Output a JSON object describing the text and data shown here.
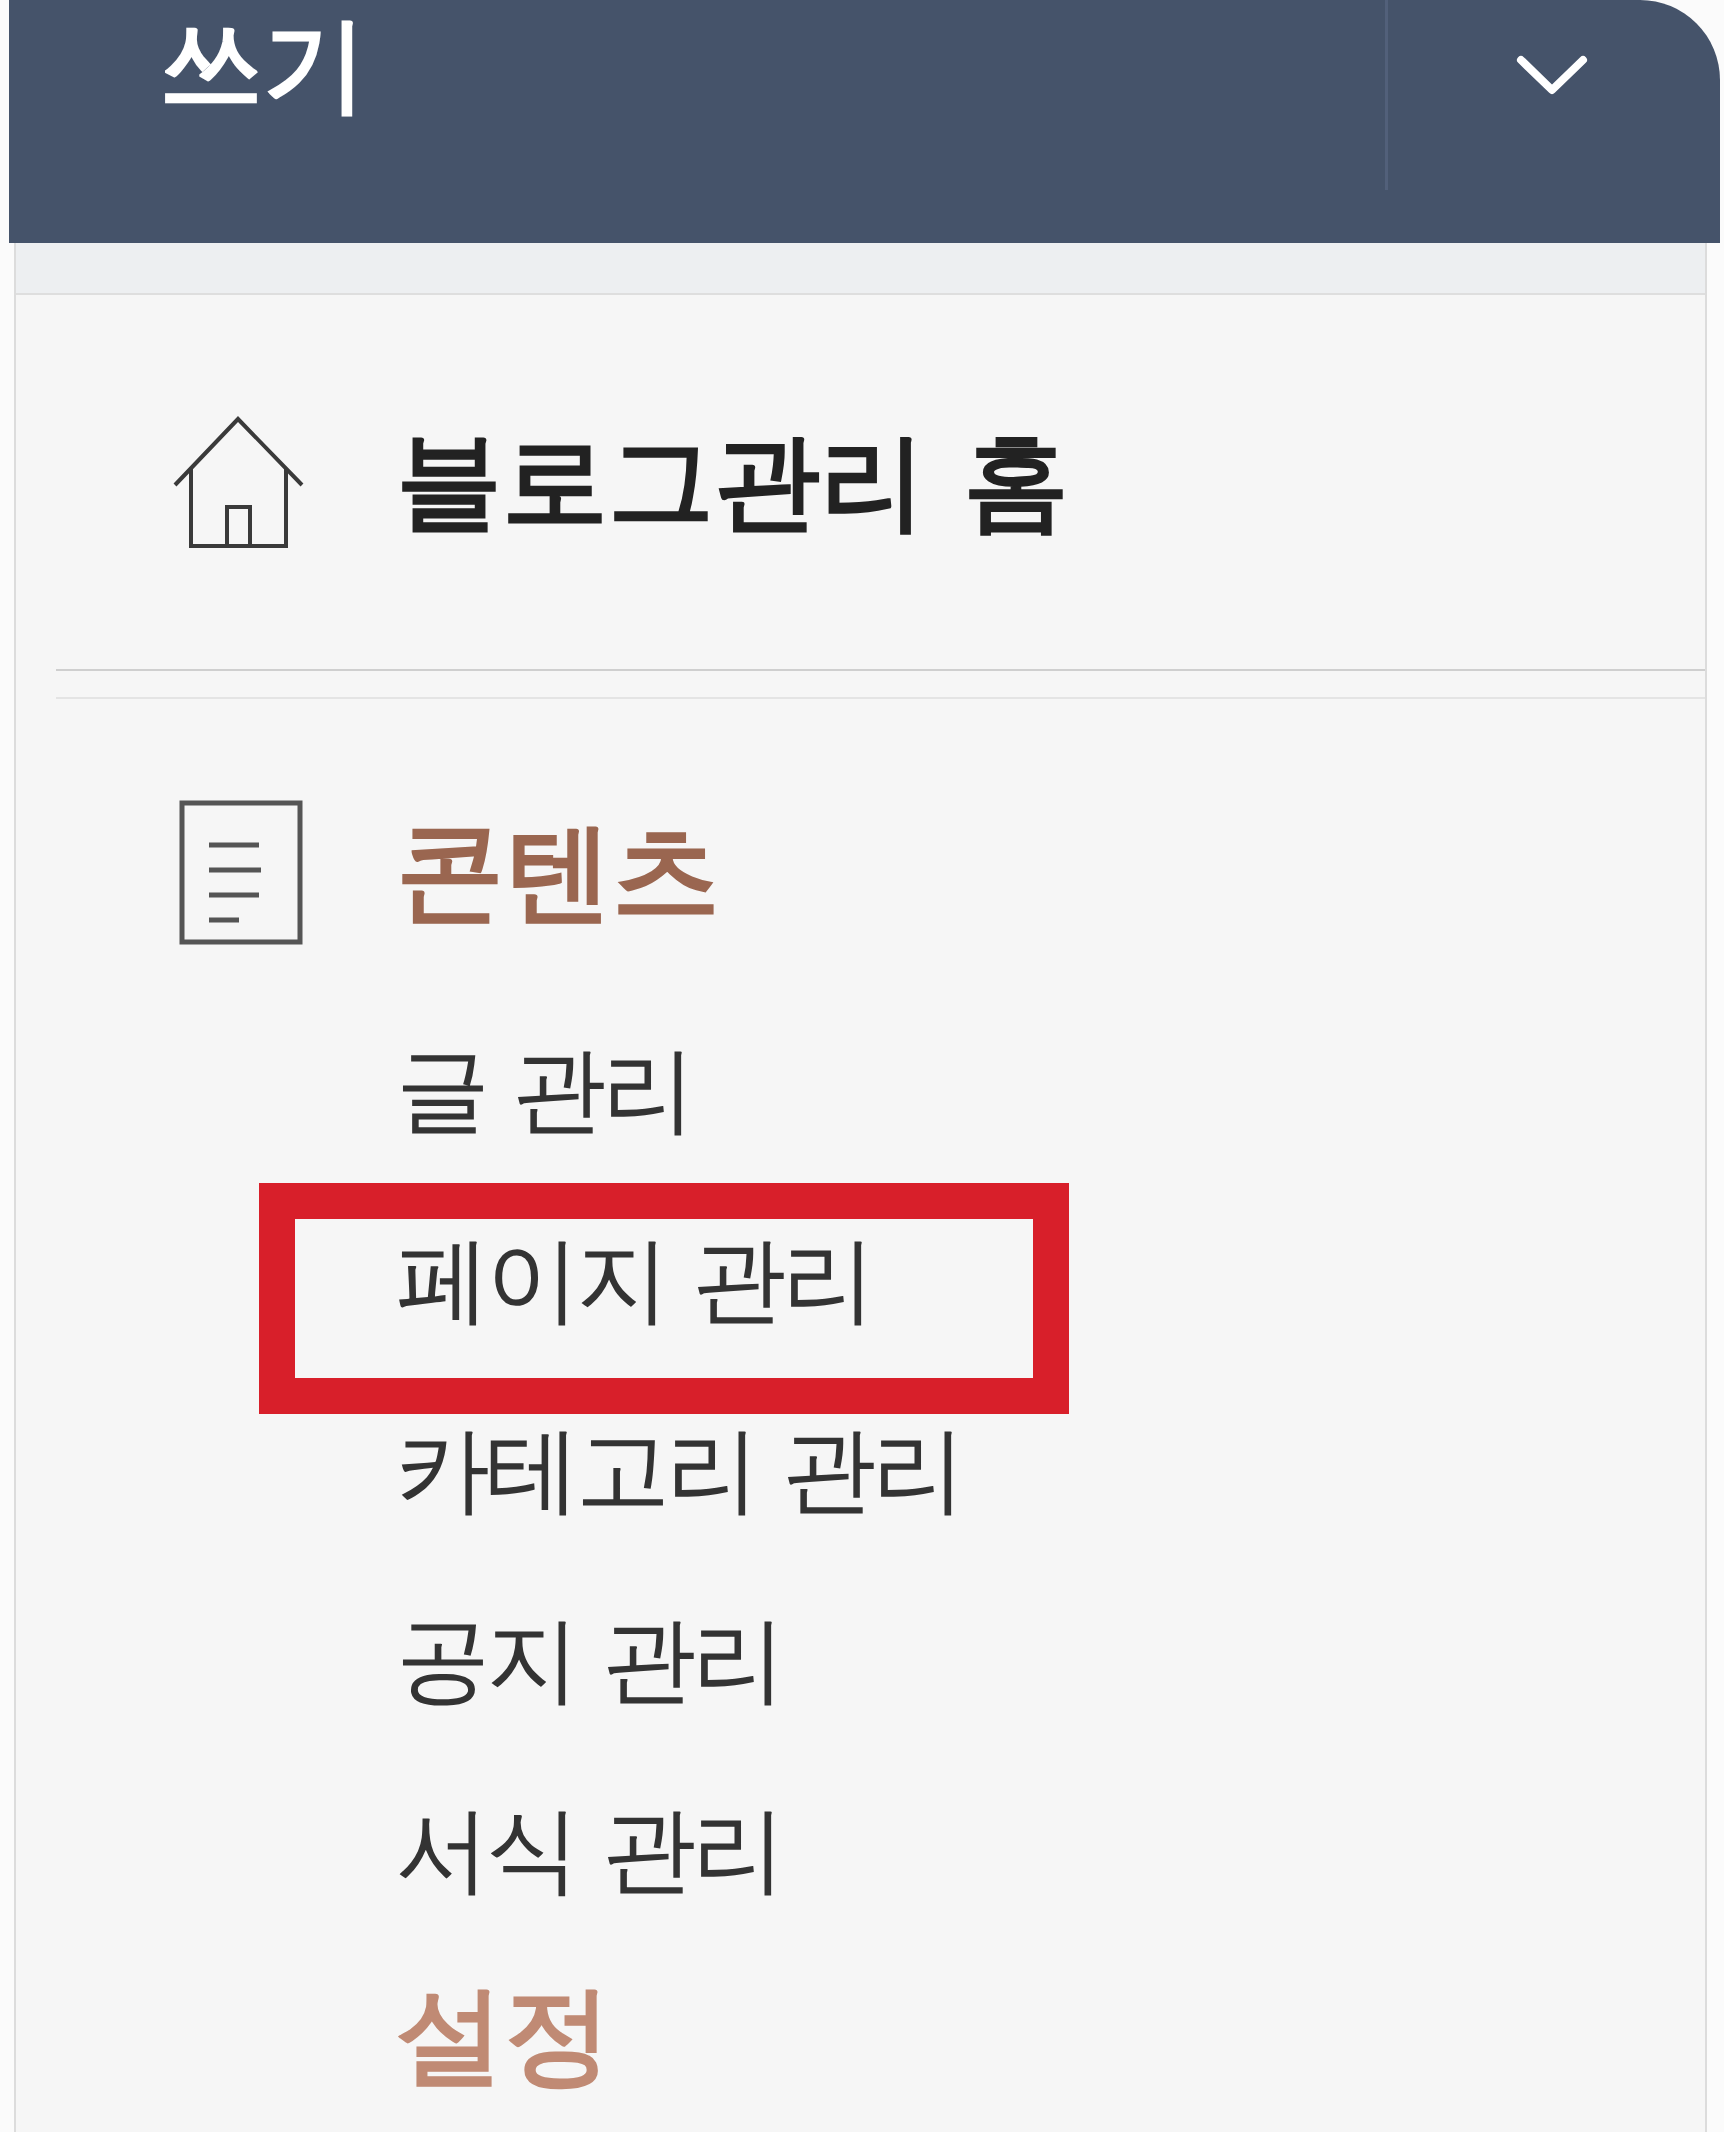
{
  "header": {
    "title": "쓰기"
  },
  "menu": {
    "home": {
      "label": "블로그관리 홈"
    },
    "sections": [
      {
        "kind": "content",
        "title": "콘텐츠",
        "items": [
          {
            "label": "글 관리",
            "highlighted": false
          },
          {
            "label": "페이지 관리",
            "highlighted": true
          },
          {
            "label": "카테고리 관리",
            "highlighted": false
          },
          {
            "label": "공지 관리",
            "highlighted": false
          },
          {
            "label": "서식 관리",
            "highlighted": false
          }
        ]
      },
      {
        "kind": "settings",
        "title": "설정"
      }
    ]
  }
}
